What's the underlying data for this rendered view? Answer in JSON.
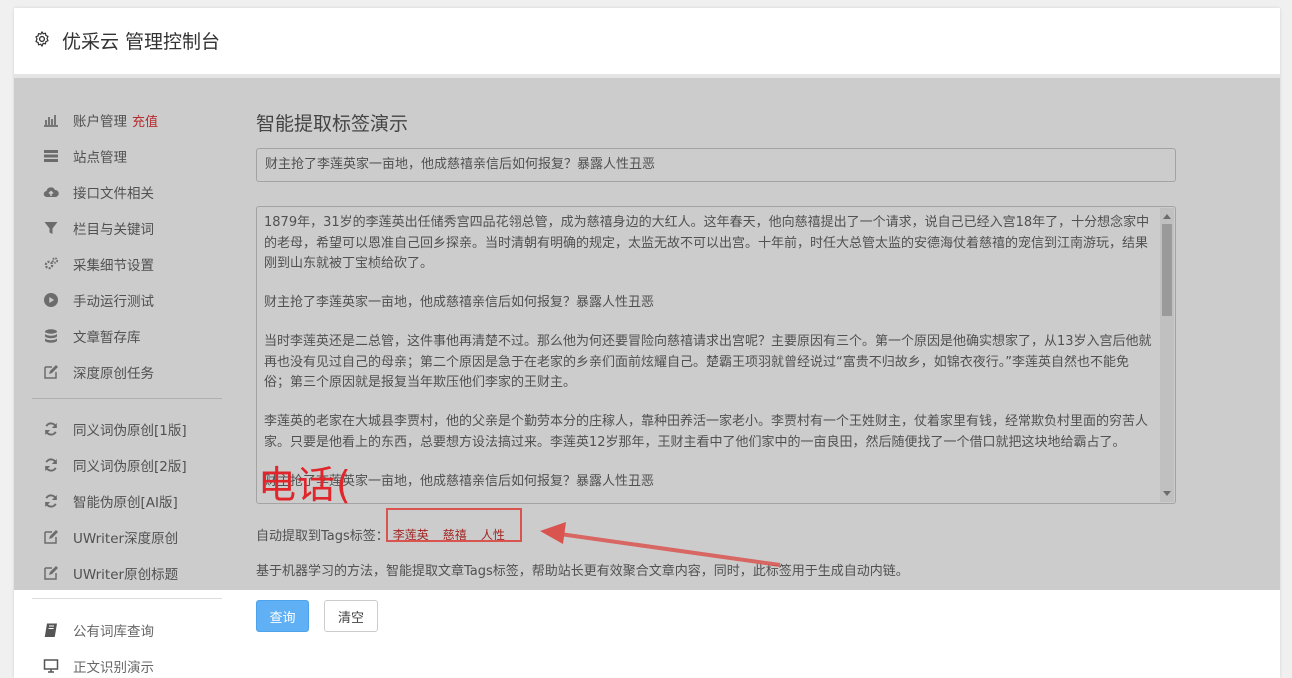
{
  "header": {
    "title": "优采云 管理控制台",
    "icon": "gear-icon"
  },
  "sidebar": {
    "items": [
      {
        "label": "账户管理",
        "badge": "充值",
        "icon": "bar-chart-icon"
      },
      {
        "label": "站点管理",
        "icon": "server-icon"
      },
      {
        "label": "接口文件相关",
        "icon": "cloud-upload-icon"
      },
      {
        "label": "栏目与关键词",
        "icon": "filter-icon"
      },
      {
        "label": "采集细节设置",
        "icon": "gears-icon"
      },
      {
        "label": "手动运行测试",
        "icon": "play-icon"
      },
      {
        "label": "文章暂存库",
        "icon": "database-icon"
      },
      {
        "label": "深度原创任务",
        "icon": "edit-icon"
      },
      {
        "label": "同义词伪原创[1版]",
        "icon": "refresh-icon"
      },
      {
        "label": "同义词伪原创[2版]",
        "icon": "refresh-icon"
      },
      {
        "label": "智能伪原创[AI版]",
        "icon": "refresh-icon"
      },
      {
        "label": "UWriter深度原创",
        "icon": "edit-icon"
      },
      {
        "label": "UWriter原创标题",
        "icon": "edit-icon"
      },
      {
        "label": "公有词库查询",
        "icon": "book-icon"
      },
      {
        "label": "正文识别演示",
        "icon": "monitor-icon"
      }
    ]
  },
  "main": {
    "page_title": "智能提取标签演示",
    "title_value": "财主抢了李莲英家一亩地，他成慈禧亲信后如何报复？暴露人性丑恶",
    "article_paragraphs": [
      "1879年，31岁的李莲英出任储秀宫四品花翎总管，成为慈禧身边的大红人。这年春天，他向慈禧提出了一个请求，说自己已经入宫18年了，十分想念家中的老母，希望可以恩准自己回乡探亲。当时清朝有明确的规定，太监无故不可以出宫。十年前，时任大总管太监的安德海仗着慈禧的宠信到江南游玩，结果刚到山东就被丁宝桢给砍了。",
      "财主抢了李莲英家一亩地，他成慈禧亲信后如何报复？暴露人性丑恶",
      "当时李莲英还是二总管，这件事他再清楚不过。那么他为何还要冒险向慈禧请求出宫呢？主要原因有三个。第一个原因是他确实想家了，从13岁入宫后他就再也没有见过自己的母亲；第二个原因是急于在老家的乡亲们面前炫耀自己。楚霸王项羽就曾经说过“富贵不归故乡，如锦衣夜行。”李莲英自然也不能免俗；第三个原因就是报复当年欺压他们李家的王财主。",
      "李莲英的老家在大城县李贾村，他的父亲是个勤劳本分的庄稼人，靠种田养活一家老小。李贾村有一个王姓财主，仗着家里有钱，经常欺负村里面的穷苦人家。只要是他看上的东西，总要想方设法搞过来。李莲英12岁那年，王财主看中了他们家中的一亩良田，然后随便找了一个借口就把这块地给霸占了。",
      "财主抢了李莲英家一亩地，他成慈禧亲信后如何报复？暴露人性丑恶"
    ],
    "tags_label": "自动提取到Tags标签：",
    "tags": [
      "李莲英",
      "慈禧",
      "人性"
    ],
    "description": "基于机器学习的方法，智能提取文章Tags标签，帮助站长更有效聚合文章内容，同时，此标签用于生成自动内链。",
    "buttons": {
      "query": "查询",
      "clear": "清空"
    }
  },
  "annotation": {
    "text": "电话(",
    "color": "#e0262a"
  }
}
